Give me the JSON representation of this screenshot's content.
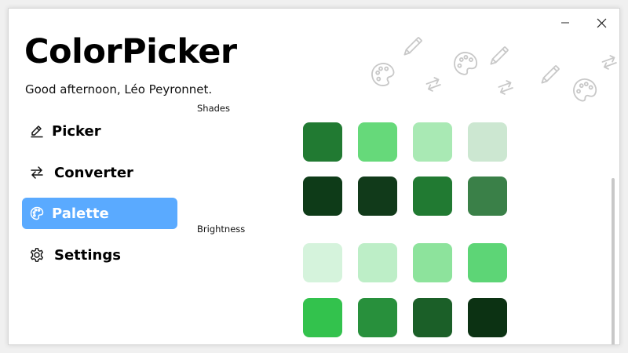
{
  "app": {
    "title": "ColorPicker",
    "greeting": "Good afternoon, Léo Peyronnet."
  },
  "window_controls": {
    "minimize_icon": "minimize-icon",
    "close_icon": "close-icon"
  },
  "nav": {
    "items": [
      {
        "label": "Picker",
        "icon": "pen-icon",
        "active": false
      },
      {
        "label": "Converter",
        "icon": "swap-arrows-icon",
        "active": false
      },
      {
        "label": "Palette",
        "icon": "palette-icon",
        "active": true
      },
      {
        "label": "Settings",
        "icon": "gear-icon",
        "active": false
      }
    ]
  },
  "sections": {
    "shades": {
      "label": "Shades",
      "rows": [
        [
          "#217a32",
          "#66d97a",
          "#a9e9b4",
          "#cce7d1"
        ],
        [
          "#0e3b18",
          "#113a1a",
          "#217a32",
          "#3a8048"
        ]
      ]
    },
    "brightness": {
      "label": "Brightness",
      "rows": [
        [
          "#d5f3dc",
          "#bdeec7",
          "#8de39c",
          "#5dd576"
        ],
        [
          "#33c24d",
          "#28903c",
          "#1b5f28",
          "#0c3213"
        ]
      ]
    }
  },
  "colors": {
    "accent": "#5aaaff",
    "deco": "#c8c8c8"
  }
}
